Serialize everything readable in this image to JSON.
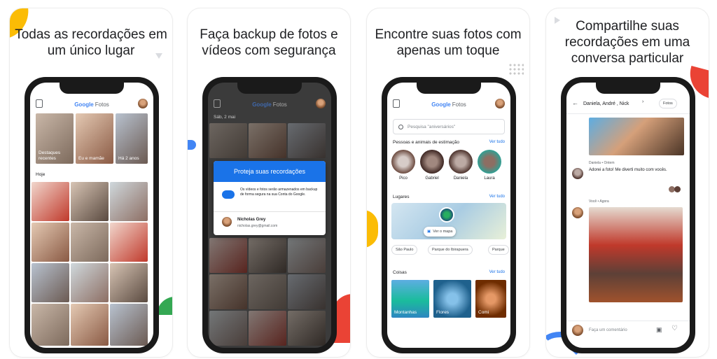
{
  "cards": [
    {
      "caption": "Todas as recordações em um único lugar",
      "app": {
        "logo_google": "Google",
        "logo_product": "Fotos"
      },
      "highlights": [
        {
          "label": "Destaques recentes"
        },
        {
          "label": "Eu e mamãe"
        },
        {
          "label": "Há 2 anos"
        }
      ],
      "section_label": "Hoje"
    },
    {
      "caption": "Faça backup de fotos e vídeos com segurança",
      "app": {
        "logo_google": "Google",
        "logo_product": "Fotos"
      },
      "date_label": "Sáb, 2 mai",
      "dialog": {
        "title": "Proteja suas recordações",
        "body": "Os vídeos e fotos serão armazenados em backup de forma segura na sua Conta do Google.",
        "account_name": "Nicholas Grey",
        "account_email": "nicholas.grey@gmail.com"
      }
    },
    {
      "caption": "Encontre suas fotos com apenas um toque",
      "app": {
        "logo_google": "Google",
        "logo_product": "Fotos"
      },
      "search_placeholder": "Pesquisa \"aniversários\"",
      "people_section": "Pessoas e animais de estimação",
      "see_all": "Ver tudo",
      "people": [
        "Pico",
        "Gabriel",
        "Daniela",
        "Laura"
      ],
      "places_section": "Lugares",
      "map_button": "Ver o mapa",
      "place_chips": [
        "São Paulo",
        "Parque do Ibirapuera",
        "Parque"
      ],
      "things_section": "Coisas",
      "things": [
        "Montanhas",
        "Flores",
        "Comi"
      ]
    },
    {
      "caption": "Compartilhe suas recordações em uma conversa particular",
      "chat_title": "Daniela, André , Nick",
      "chat_button": "Fotos",
      "message1_meta": "Daniela • Ontem",
      "message1_text": "Adorei a foto! Me diverti muito com vocês.",
      "message2_meta": "Você • Agora",
      "comment_placeholder": "Faça um comentário"
    }
  ],
  "colors": {
    "blue": "#1a73e8",
    "red": "#ea4335",
    "yellow": "#fbbc05",
    "green": "#34a853"
  }
}
